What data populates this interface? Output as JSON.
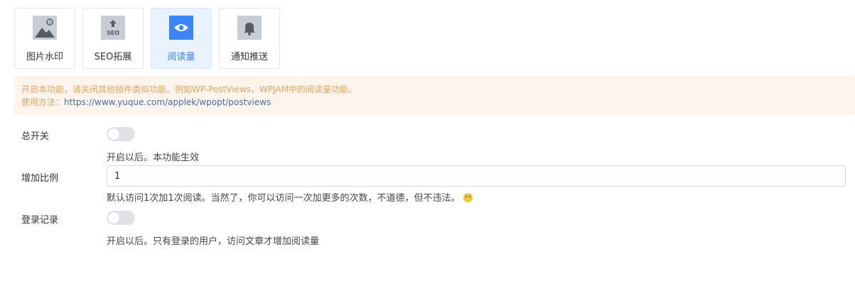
{
  "tabs": [
    {
      "label": "图片水印",
      "icon": "image-watermark-icon"
    },
    {
      "label": "SEO拓展",
      "icon": "seo-upload-icon",
      "icon_text": "SEO"
    },
    {
      "label": "阅读量",
      "icon": "eye-icon",
      "active": true
    },
    {
      "label": "通知推送",
      "icon": "bell-icon"
    }
  ],
  "notice": {
    "line1": "开启本功能，请关闭其他插件类似功能。例如WP-PostViews，WPJAM中的阅读量功能。",
    "usage_prefix": "使用方法：",
    "usage_link": "https://www.yuque.com/applek/wpopt/postviews"
  },
  "settings": {
    "master_switch": {
      "label": "总开关",
      "enabled": false,
      "help": "开启以后。本功能生效"
    },
    "ratio": {
      "label": "增加比例",
      "value": "1",
      "help": "默认访问1次加1次阅读。当然了，你可以访问一次加更多的次数，不道德，但不违法。"
    },
    "login_record": {
      "label": "登录记录",
      "enabled": false,
      "help": "开启以后。只有登录的用户，访问文章才增加阅读量"
    }
  },
  "colors": {
    "accent": "#3a86f7",
    "notice_text": "#e9a25d",
    "notice_bg": "#fdf5ec",
    "link": "#3d6fb4"
  }
}
